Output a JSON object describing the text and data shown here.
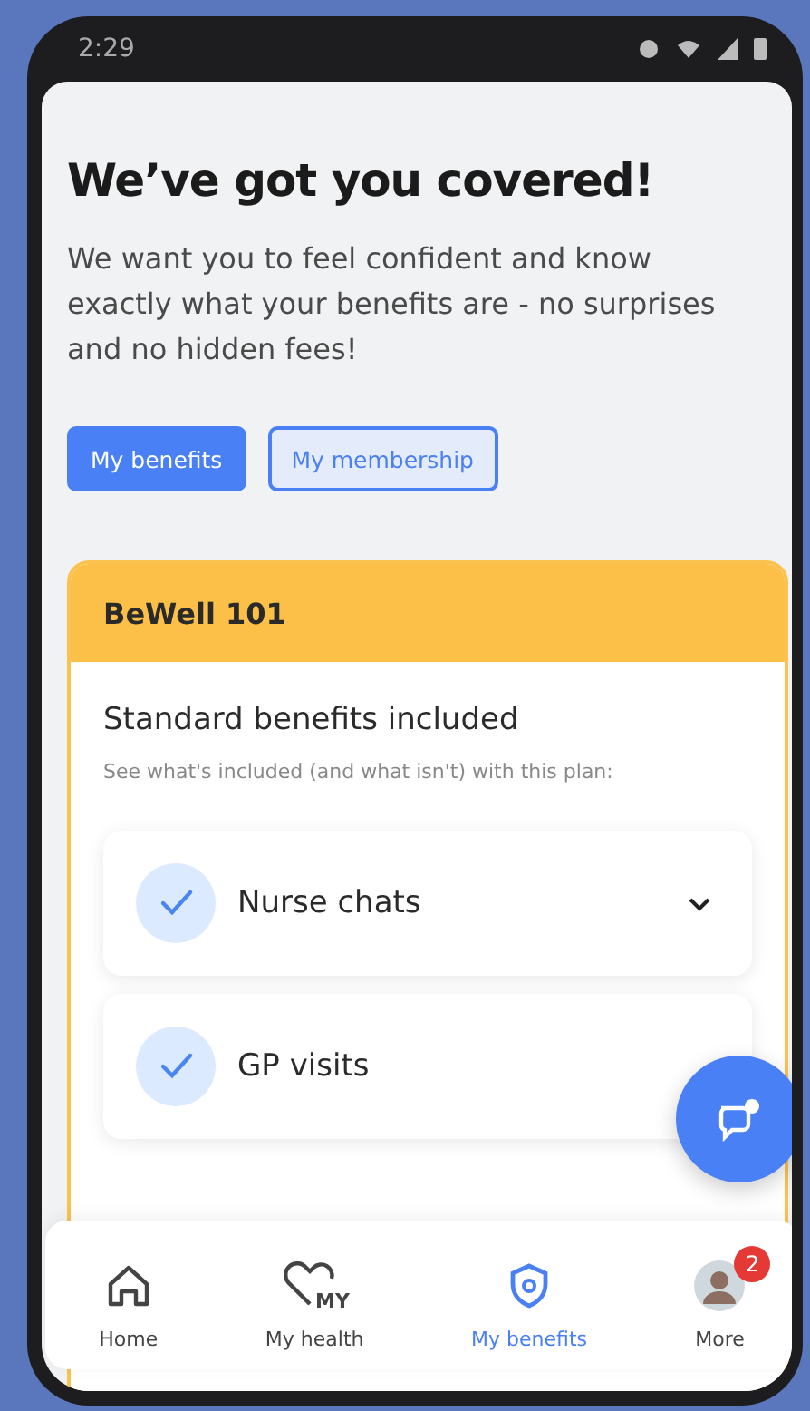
{
  "status_bar": {
    "time": "2:29"
  },
  "title": "We’ve got you covered!",
  "intro": "We want you to feel confident and know exactly what your benefits are - no surprises and no hidden fees!",
  "tabs": [
    {
      "label": "My benefits",
      "selected": true
    },
    {
      "label": "My membership",
      "selected": false
    }
  ],
  "plan": {
    "name": "BeWell 101",
    "heading": "Standard benefits included",
    "subtitle": "See what's included (and what isn't) with this plan:",
    "benefits": [
      {
        "label": "Nurse chats",
        "included": true,
        "expanded": false
      },
      {
        "label": "GP visits",
        "included": true
      }
    ]
  },
  "nav": [
    {
      "label": "Home",
      "kind": "home",
      "selected": false
    },
    {
      "label": "My health",
      "kind": "health",
      "icon_text": "MY",
      "selected": false
    },
    {
      "label": "My benefits",
      "kind": "benefits",
      "selected": true
    },
    {
      "label": "More",
      "kind": "profile",
      "badge": "2",
      "selected": false
    }
  ]
}
